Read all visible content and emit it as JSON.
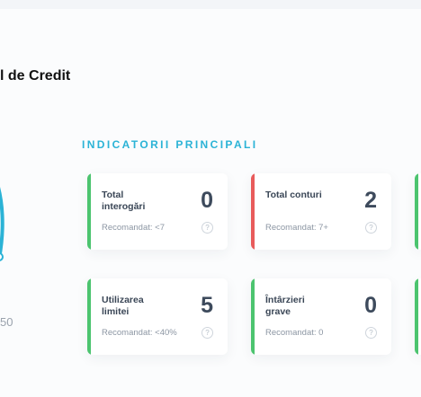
{
  "header": {
    "title_fragment": "l de Credit"
  },
  "score": {
    "value_fragment": "50"
  },
  "section": {
    "label": "INDICATORII PRINCIPALI"
  },
  "colors": {
    "good": "#4cc46f",
    "bad": "#e85b5b",
    "accent": "#2bb3d6",
    "gauge": "#2bb3d6"
  },
  "cards": [
    {
      "label": "Total interogări",
      "value": "0",
      "recommended": "Recomandat: <7",
      "status": "good",
      "info_icon": "?"
    },
    {
      "label": "Total conturi",
      "value": "2",
      "recommended": "Recomandat: 7+",
      "status": "bad",
      "info_icon": "?"
    },
    {
      "label": "Utilizarea limitei",
      "value": "5",
      "recommended": "Recomandat: <40%",
      "status": "good",
      "info_icon": "?"
    },
    {
      "label": "Întârzieri grave",
      "value": "0",
      "recommended": "Recomandat: 0",
      "status": "good",
      "info_icon": "?"
    }
  ]
}
